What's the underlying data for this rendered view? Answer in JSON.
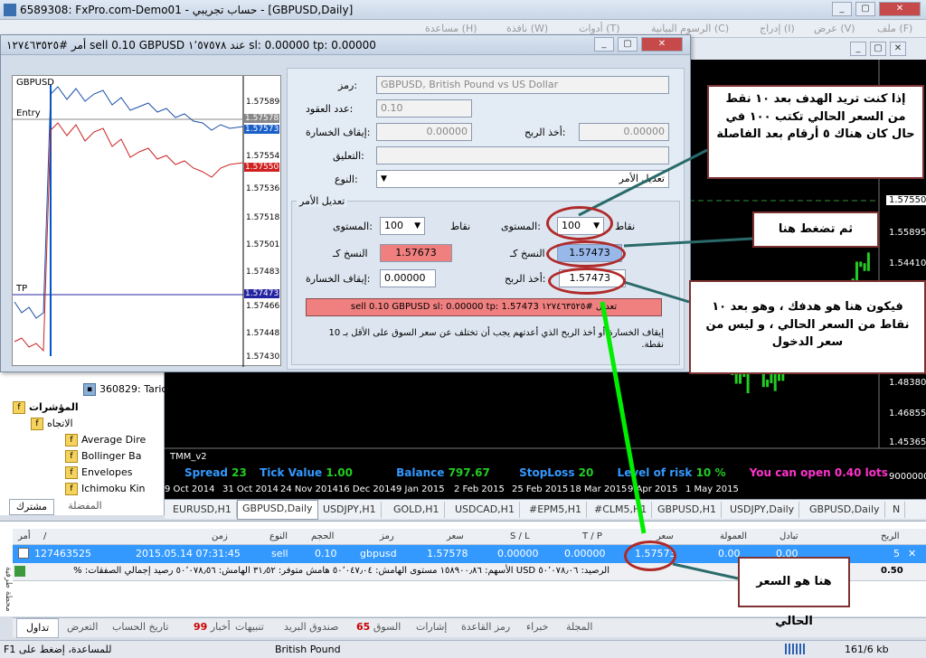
{
  "window": {
    "title": "6589308: FxPro.com-Demo01 - حساب تجريبي - [GBPUSD,Daily]"
  },
  "menu": [
    "ملف (F)",
    "عرض (V)",
    "إدراج (I)",
    "الرسوم البيانية (C)",
    "أدوات (T)",
    "نافذة (W)",
    "مساعدة (H)"
  ],
  "dialog": {
    "title": "أمر #١٢٧٤٦٣٥٢٥ sell 0.10 GBPUSD عند ١٬٥٧٥٧٨ sl: 0.00000 tp: 0.00000",
    "mini_chart": {
      "symbol": "GBPUSD",
      "ask": "1.57578",
      "bid": "1.57573",
      "red": "1.57550",
      "tp": "1.57473",
      "entry_label": "Entry",
      "tp_label": "TP",
      "ticks": [
        "1.57589",
        "1.57554",
        "1.57536",
        "1.57518",
        "1.57501",
        "1.57483",
        "1.57466",
        "1.57448",
        "1.57430"
      ]
    },
    "form": {
      "symbol_label": "رمز:",
      "symbol_value": "GBPUSD, British Pound vs US Dollar",
      "volume_label": "عدد العقود:",
      "volume_value": "0.10",
      "sl_label": "إيقاف الخسارة:",
      "sl_value": "0.00000",
      "tp_label": "أخذ الربح:",
      "tp_value": "0.00000",
      "comment_label": "التعليق:",
      "type_label": "النوع:",
      "type_value": "تعديل الأمر",
      "modify_group": "تعديل الأمر",
      "level_label": "المستوى:",
      "points_label": "نقاط",
      "level_left": "100",
      "level_right": "100",
      "copy_label": "النسخ كـ",
      "copy_left": "1.57673",
      "copy_right": "1.57473",
      "sl2_label": "إيقاف الخسارة:",
      "sl2_value": "0.00000",
      "tp2_label": "أخذ الربح:",
      "tp2_value": "1.57473",
      "modify_button": "تعديل #١٢٧٤٦٣٥٢٥ sell 0.10 GBPUSD sl: 0.00000 tp: 1.57473",
      "note": "إيقاف الخسارة أو أخذ الربح الذي أعدتهم يجب أن تختلف عن سعر السوق على الأقل بـ 10 نقطة."
    }
  },
  "callouts": {
    "c1": "إذا كنت تريد الهدف بعد ١٠ نقط من السعر الحالي تكتب ١٠٠ في حال كان هناك ٥ أرقام بعد الفاصلة",
    "c2": "ثم تضغط هنا",
    "c3": "فيكون هنا هو هدفك ، وهو بعد ١٠ نقاط من السعر الحالي ، و ليس من سعر الدخول",
    "c4": "هنا هو السعر الحالي"
  },
  "chart": {
    "ticks": [
      "1.57550",
      "1.55895",
      "1.54410",
      "1.48380",
      "1.46855",
      "1.45365",
      "9000000"
    ],
    "dates": [
      "9 Oct 2014",
      "31 Oct 2014",
      "24 Nov 2014",
      "16 Dec 2014",
      "9 Jan 2015",
      "2 Feb 2015",
      "25 Feb 2015",
      "18 Mar 2015",
      "9 Apr 2015",
      "1 May 2015"
    ],
    "indicator": "TMM_v2",
    "spread_label": "Spread",
    "spread": "23",
    "tick_label": "Tick Value",
    "tick": "1.00",
    "balance_label": "Balance",
    "balance": "797.67",
    "stoploss_label": "StopLoss",
    "stoploss": "20",
    "risk_label": "Level of risk",
    "risk": "10 %",
    "canopen": "You can open 0.40 lots",
    "tabs": [
      "EURUSD,H1",
      "GBPUSD,Daily",
      "USDJPY,H1",
      "GOLD,H1",
      "USDCAD,H1",
      "#EPM5,H1",
      "#CLM5,H1",
      "GBPUSD,H1",
      "USDJPY,Daily",
      "GBPUSD,Daily",
      "N"
    ]
  },
  "navigator": {
    "account": "360829: Taric",
    "indicators": "المؤشرات",
    "trend": "الاتجاه",
    "items": [
      "Average Dire",
      "Bollinger Ba",
      "Envelopes",
      "Ichimoku Kin"
    ],
    "tab_common": "مشترك",
    "tab_fav": "المفضلة"
  },
  "terminal": {
    "side_label": "محطة طرفية",
    "headers": [
      "أمر",
      "/",
      "زمن",
      "النوع",
      "الحجم",
      "رمز",
      "سعر",
      "S / L",
      "T / P",
      "سعر",
      "العمولة",
      "تبادل",
      "الربح"
    ],
    "row": {
      "order": "127463525",
      "time": "2015.05.14 07:31:45",
      "type": "sell",
      "volume": "0.10",
      "symbol": "gbpusd",
      "open": "1.57578",
      "sl": "0.00000",
      "tp": "0.00000",
      "price": "1.57573",
      "commission": "0.00",
      "swap": "0.00",
      "profit": "5"
    },
    "balance_line": "الرصيد: ٥٠٬٠٧٨٫٠٦ USD  الأسهم: ١٥٨٩٠٠٫٨٦  مستوى الهامش: ٥٠٬٠٤٧٫٠٤  هامش متوفر: ٣١٫٥٢  الهامش: ٥٠٬٠٧٨٫٥٦  رصيد إجمالي الصفقات: %",
    "balance_total": "0.50",
    "tabs": [
      "تداول",
      "التعرض",
      "تاريخ الحساب",
      "أخبار",
      "تنبيهات",
      "صندوق البريد",
      "السوق",
      "إشارات",
      "رمز القاعدة",
      "خبراء",
      "المجلة"
    ],
    "news_count": "99",
    "market_count": "65"
  },
  "status": {
    "help": "للمساعدة، إضغط على F1",
    "symbol": "British Pound",
    "traffic": "161/6 kb"
  }
}
